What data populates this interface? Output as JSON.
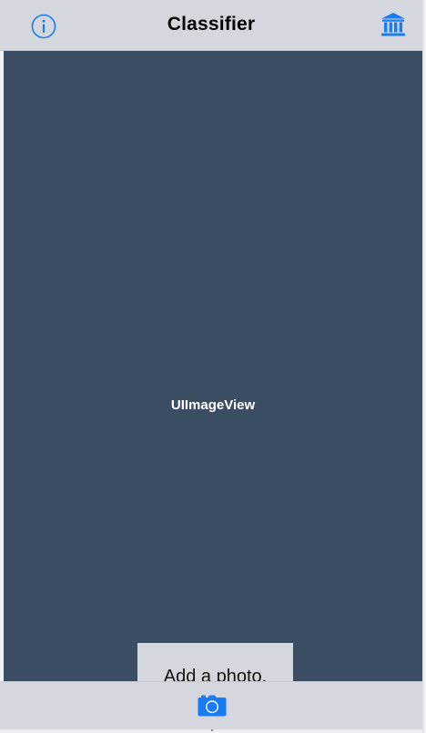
{
  "navbar": {
    "title": "Classifier",
    "left_icon": "info-icon",
    "right_icon": "bank-icon"
  },
  "image_view": {
    "label": "UIImageView"
  },
  "add_photo": {
    "label": "Add a photo."
  },
  "toolbar": {
    "camera_icon": "camera-icon"
  },
  "colors": {
    "accent": "#1a7cf5",
    "image_view_bg": "#3b4d63",
    "bar_bg": "#d4d8de"
  }
}
